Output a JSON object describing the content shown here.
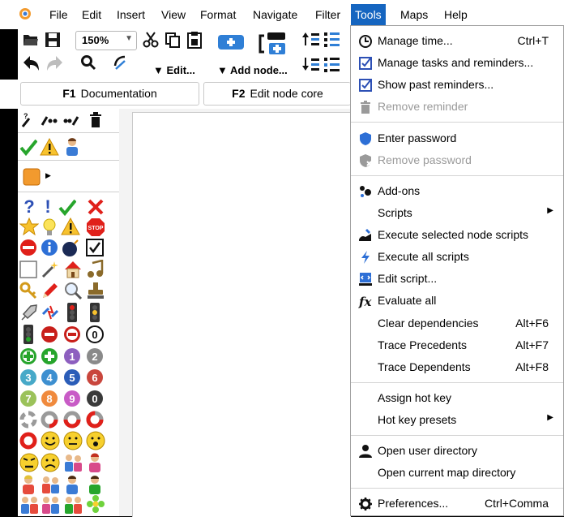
{
  "menubar": {
    "items": [
      {
        "label": "File"
      },
      {
        "label": "Edit"
      },
      {
        "label": "Insert"
      },
      {
        "label": "View"
      },
      {
        "label": "Format"
      },
      {
        "label": "Navigate"
      },
      {
        "label": "Filter"
      },
      {
        "label": "Tools"
      },
      {
        "label": "Maps"
      },
      {
        "label": "Help"
      }
    ],
    "active": "Tools"
  },
  "toolbar": {
    "zoom": "150%",
    "edit_label": "▼ Edit...",
    "add_node_label": "▼ Add node..."
  },
  "fkeys": [
    {
      "key": "F1",
      "label": "Documentation"
    },
    {
      "key": "F2",
      "label": "Edit node core"
    }
  ],
  "tools_menu": {
    "items": [
      {
        "label": "Manage time...",
        "shortcut": "Ctrl+T",
        "icon": "clock-icon"
      },
      {
        "label": "Manage tasks and reminders...",
        "icon": "checkbox-icon"
      },
      {
        "label": "Show past reminders...",
        "icon": "checkbox-icon"
      },
      {
        "label": "Remove reminder",
        "icon": "trash-icon",
        "disabled": true
      },
      {
        "label": "Enter password",
        "icon": "shield-icon"
      },
      {
        "label": "Remove password",
        "icon": "shield-icon",
        "disabled": true
      },
      {
        "label": "Add-ons",
        "icon": "addons-icon"
      },
      {
        "label": "Scripts",
        "submenu": true
      },
      {
        "label": "Execute selected node scripts",
        "icon": "execute-selected-icon"
      },
      {
        "label": "Execute all scripts",
        "icon": "lightning-icon"
      },
      {
        "label": "Edit script...",
        "icon": "edit-script-icon"
      },
      {
        "label": "Evaluate all",
        "icon": "fx-icon"
      },
      {
        "label": "Clear dependencies",
        "shortcut": "Alt+F6"
      },
      {
        "label": "Trace Precedents",
        "shortcut": "Alt+F7"
      },
      {
        "label": "Trace Dependents",
        "shortcut": "Alt+F8"
      },
      {
        "label": "Assign hot key"
      },
      {
        "label": "Hot key presets",
        "submenu": true
      },
      {
        "label": "Open user directory",
        "icon": "user-icon"
      },
      {
        "label": "Open current map directory"
      },
      {
        "label": "Preferences...",
        "shortcut": "Ctrl+Comma",
        "icon": "gear-icon"
      }
    ]
  },
  "icon_panel": {
    "question_label": "?",
    "exclaim_label": "!",
    "stop_label": "STOP",
    "num_1": "1",
    "num_2": "2",
    "num_3": "3",
    "num_4": "4",
    "num_5": "5",
    "num_6": "6",
    "num_7": "7",
    "num_8": "8",
    "num_9": "9",
    "num_0": "0"
  },
  "colors": {
    "accent": "#1565c0",
    "red": "#e0201a",
    "green": "#27a52c"
  }
}
